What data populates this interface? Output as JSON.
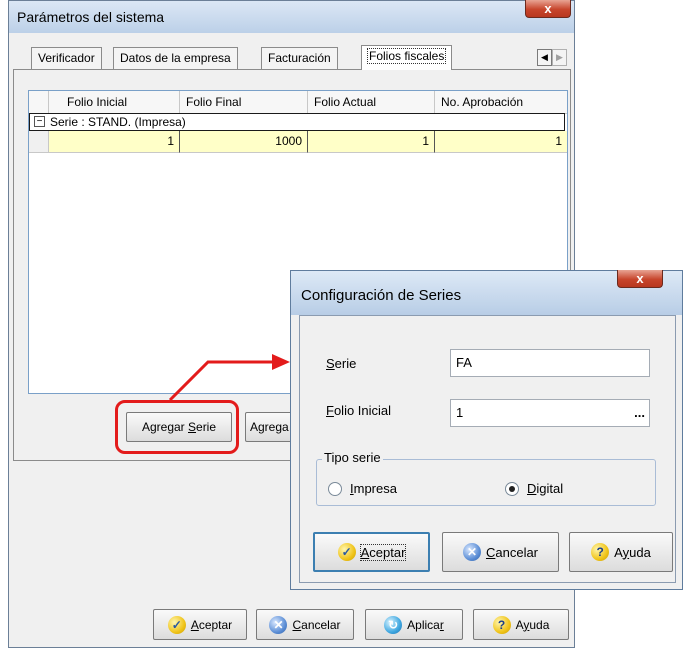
{
  "main_window": {
    "title": "Parámetros del sistema",
    "close_glyph": "x",
    "tabs": [
      "Verificador",
      "Datos de la empresa",
      "Facturación",
      "Folios fiscales"
    ],
    "active_tab_index": 3,
    "tab_scroll": {
      "left": "◀",
      "right": "▶"
    },
    "grid": {
      "columns": [
        "Folio Inicial",
        "Folio Final",
        "Folio Actual",
        "No. Aprobación"
      ],
      "group_toggle": "−",
      "group_label": "Serie : STAND. (Impresa)",
      "rows": [
        {
          "folio_inicial": "1",
          "folio_final": "1000",
          "folio_actual": "1",
          "no_aprobacion": "1"
        }
      ]
    },
    "grid_buttons": {
      "agregar_serie": "Agregar Serie",
      "agregar_partial": "Agrega"
    },
    "footer_buttons": {
      "aceptar": "Aceptar",
      "cancelar": "Cancelar",
      "aplicar": "Aplicar",
      "ayuda": "Ayuda"
    }
  },
  "dialog": {
    "title": "Configuración de Series",
    "close_glyph": "x",
    "serie_label": "Serie",
    "serie_value": "FA",
    "folio_inicial_label": "Folio Inicial",
    "folio_inicial_value": "1",
    "browse_button": "...",
    "tipo_serie_legend": "Tipo serie",
    "radio_impresa": "Impresa",
    "radio_digital": "Digital",
    "selected_tipo": "Digital",
    "buttons": {
      "aceptar": "Aceptar",
      "cancelar": "Cancelar",
      "ayuda": "Ayuda"
    }
  },
  "annotation": {
    "highlight_color": "#e31b1b",
    "arrow_color": "#e31b1b"
  },
  "icons": {
    "aceptar": "check-icon",
    "cancelar": "x-circle-icon",
    "aplicar": "refresh-icon",
    "ayuda": "question-icon"
  }
}
